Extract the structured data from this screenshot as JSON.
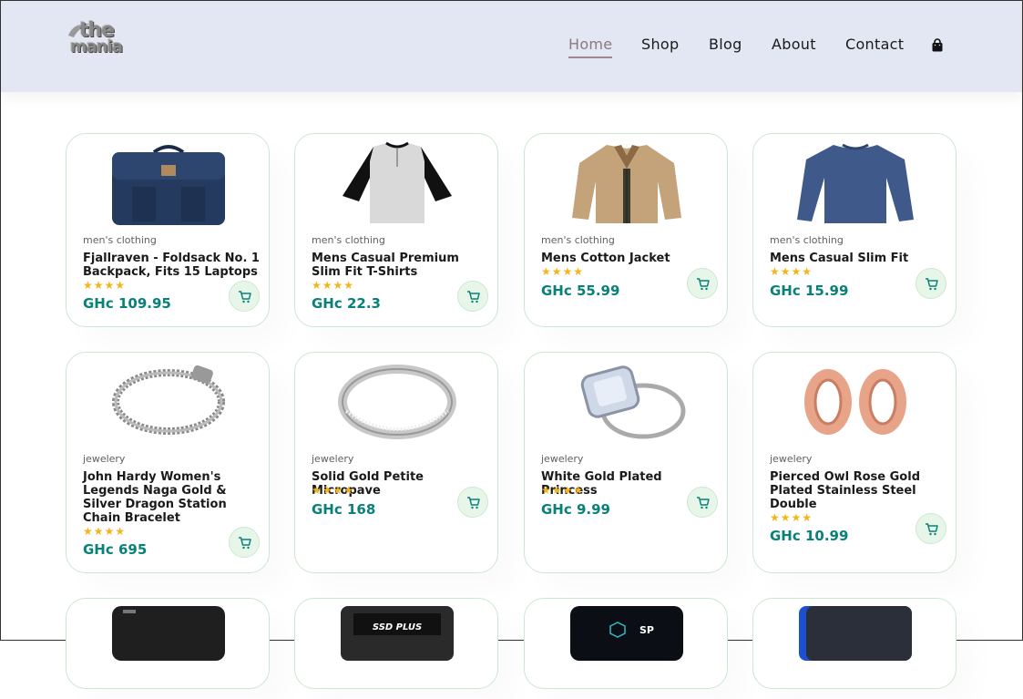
{
  "brand": {
    "logo_line1": "the",
    "logo_line2": "mania"
  },
  "nav": {
    "items": [
      {
        "label": "Home",
        "active": true
      },
      {
        "label": "Shop",
        "active": false
      },
      {
        "label": "Blog",
        "active": false
      },
      {
        "label": "About",
        "active": false
      },
      {
        "label": "Contact",
        "active": false
      }
    ],
    "cart_icon": "shopping-bag-icon"
  },
  "colors": {
    "header_bg": "#e3e6f3",
    "price": "#088178",
    "star": "#f3b519",
    "card_border": "#cce7d0",
    "cart_bg": "#e8f6ea"
  },
  "products": [
    {
      "category": "men's clothing",
      "title": "Fjallraven - Foldsack No. 1 Backpack, Fits 15 Laptops",
      "stars": "★★★★",
      "price": "GHc 109.95",
      "image": "backpack"
    },
    {
      "category": "men's clothing",
      "title": "Mens Casual Premium Slim Fit T-Shirts",
      "stars": "★★★★",
      "price": "GHc 22.3",
      "image": "raglan-tshirt"
    },
    {
      "category": "men's clothing",
      "title": "Mens Cotton Jacket",
      "stars": "★★★★",
      "price": "GHc 55.99",
      "image": "jacket"
    },
    {
      "category": "men's clothing",
      "title": "Mens Casual Slim Fit",
      "stars": "★★★★",
      "price": "GHc 15.99",
      "image": "longsleeve"
    },
    {
      "category": "jewelery",
      "title": "John Hardy Women's Legends Naga Gold & Silver Dragon Station Chain Bracelet",
      "stars": "★★★★",
      "price": "GHc 695",
      "image": "bracelet"
    },
    {
      "category": "jewelery",
      "title": "Solid Gold Petite Micropave",
      "stars": "★★★★",
      "price": "GHc 168",
      "image": "ring"
    },
    {
      "category": "jewelery",
      "title": "White Gold Plated Princess",
      "stars": "★★★★",
      "price": "GHc 9.99",
      "image": "diamond-ring"
    },
    {
      "category": "jewelery",
      "title": "Pierced Owl Rose Gold Plated Stainless Steel Double",
      "stars": "★★★★",
      "price": "GHc 10.99",
      "image": "plugs"
    },
    {
      "category": "",
      "title": "",
      "stars": "",
      "price": "",
      "image": "hard-drive"
    },
    {
      "category": "",
      "title": "",
      "stars": "",
      "price": "",
      "image": "ssd",
      "image_text": "SSD PLUS"
    },
    {
      "category": "",
      "title": "",
      "stars": "",
      "price": "",
      "image": "sp-drive",
      "image_text": "SP"
    },
    {
      "category": "",
      "title": "",
      "stars": "",
      "price": "",
      "image": "blue-drive"
    }
  ]
}
